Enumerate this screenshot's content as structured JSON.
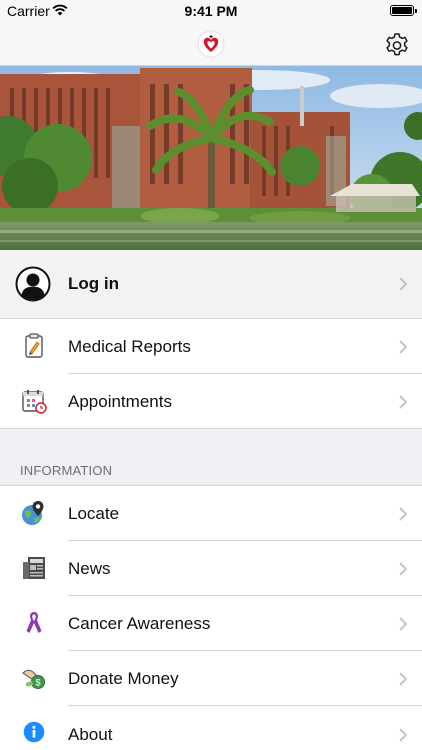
{
  "status_bar": {
    "carrier": "Carrier",
    "time": "9:41 PM",
    "wifi_icon": "wifi-icon",
    "battery_icon": "battery-icon"
  },
  "nav_bar": {
    "logo_icon": "hospital-logo-icon",
    "settings_icon": "gear-icon"
  },
  "hero": {
    "image": "hospital building with palm trees photo"
  },
  "account": {
    "login_label": "Log in",
    "avatar_icon": "user-avatar-icon"
  },
  "records": [
    {
      "label": "Medical Reports",
      "icon": "medical-report-icon"
    },
    {
      "label": "Appointments",
      "icon": "appointment-calendar-icon"
    }
  ],
  "information": {
    "header": "INFORMATION",
    "items": [
      {
        "label": "Locate",
        "icon": "globe-location-icon"
      },
      {
        "label": "News",
        "icon": "newspaper-icon"
      },
      {
        "label": "Cancer Awareness",
        "icon": "awareness-ribbon-icon"
      },
      {
        "label": "Donate Money",
        "icon": "donate-money-icon"
      },
      {
        "label": "About",
        "icon": "info-icon"
      }
    ]
  },
  "colors": {
    "background": "#efeff4",
    "ribbon": "#8b3fb0",
    "info_blue": "#1a8cff",
    "brand_red": "#d3162e"
  }
}
